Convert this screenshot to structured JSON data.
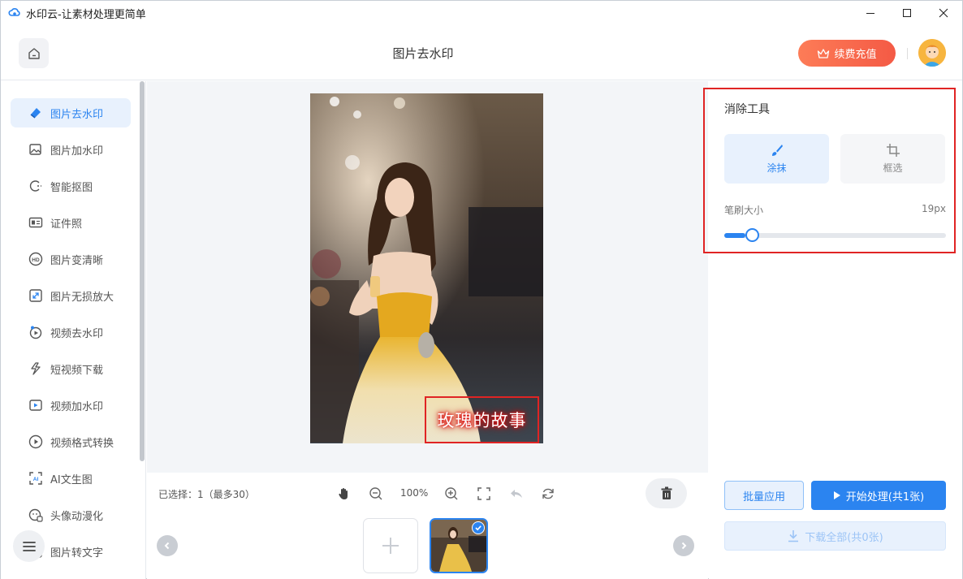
{
  "window": {
    "title": "水印云-让素材处理更简单",
    "controls": [
      "minimize-icon",
      "maximize-icon",
      "close-icon"
    ]
  },
  "header": {
    "page_title": "图片去水印",
    "vip_button": "续费充值"
  },
  "sidebar": {
    "items": [
      {
        "label": "图片去水印",
        "icon": "eraser-icon",
        "active": true
      },
      {
        "label": "图片加水印",
        "icon": "image-add-icon"
      },
      {
        "label": "智能抠图",
        "icon": "cutout-icon"
      },
      {
        "label": "证件照",
        "icon": "id-card-icon"
      },
      {
        "label": "图片变清晰",
        "icon": "hd-icon"
      },
      {
        "label": "图片无损放大",
        "icon": "enlarge-icon"
      },
      {
        "label": "视频去水印",
        "icon": "video-eraser-icon"
      },
      {
        "label": "短视频下载",
        "icon": "tiktok-icon"
      },
      {
        "label": "视频加水印",
        "icon": "video-add-icon"
      },
      {
        "label": "视频格式转换",
        "icon": "play-circle-icon"
      },
      {
        "label": "AI文生图",
        "icon": "ai-icon"
      },
      {
        "label": "头像动漫化",
        "icon": "avatar-anime-icon"
      },
      {
        "label": "图片转文字",
        "icon": "ocr-icon"
      }
    ]
  },
  "canvas": {
    "watermark_text": "玫瑰的故事",
    "selected_count": "已选择：1（最多30）",
    "zoom": "100%"
  },
  "tools": {
    "title": "消除工具",
    "smear_label": "涂抹",
    "box_label": "框选",
    "brush_size_label": "笔刷大小",
    "brush_size_value": "19px",
    "brush_size_fraction": 0.08
  },
  "actions": {
    "batch_apply": "批量应用",
    "start_process": "开始处理(共1张)",
    "download_all": "下载全部(共0张)"
  },
  "colors": {
    "accent": "#2b84f0",
    "highlight_box": "#e02424",
    "vip_gradient_start": "#fd7c57",
    "vip_gradient_end": "#f45a45"
  }
}
